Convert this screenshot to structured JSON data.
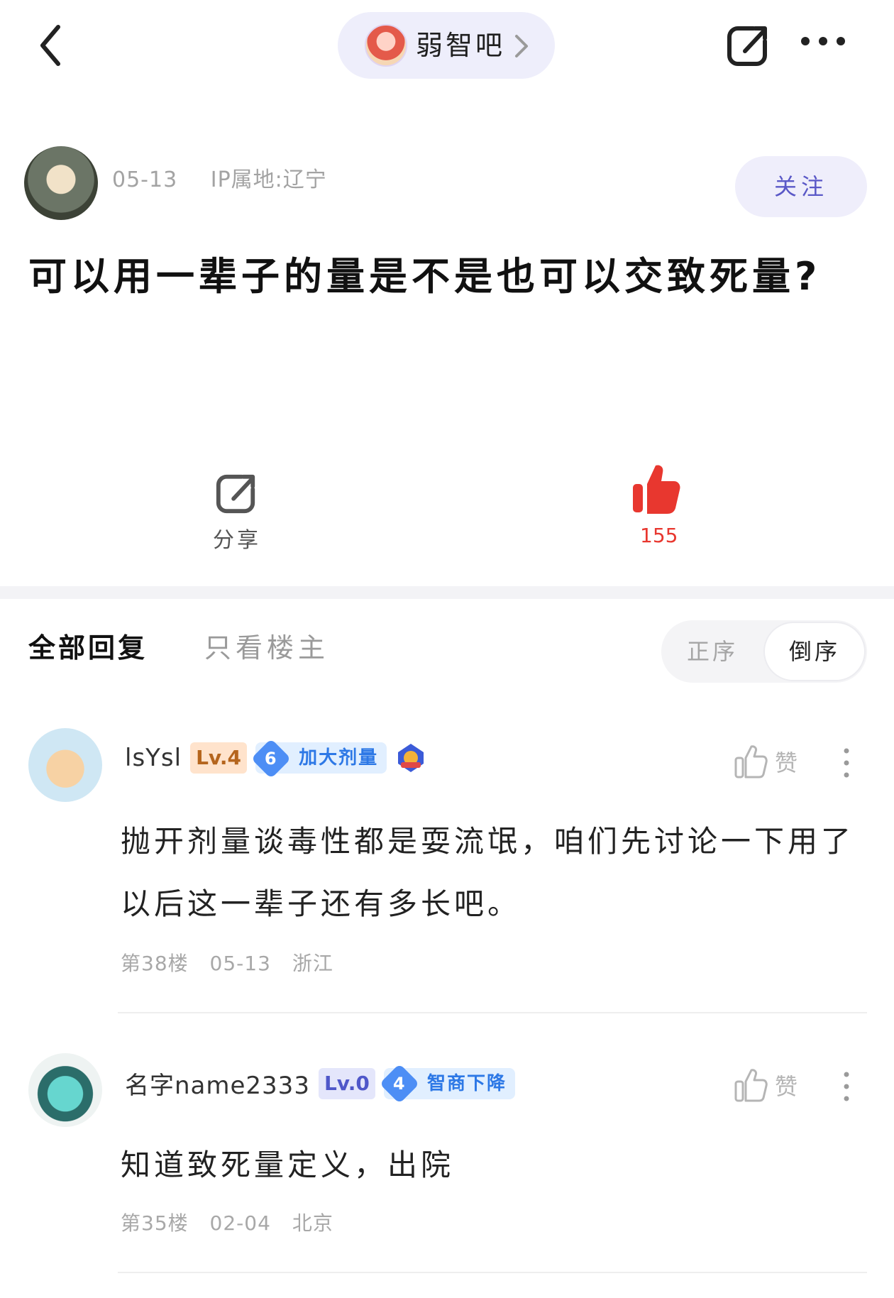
{
  "header": {
    "forum_name": "弱智吧",
    "back_icon": "back-arrow-icon",
    "share_icon": "share-icon",
    "more_icon": "more-icon"
  },
  "post": {
    "date": "05-13",
    "ip_location": "IP属地:辽宁",
    "follow_label": "关注",
    "title": "可以用一辈子的量是不是也可以交致死量?"
  },
  "actions": {
    "share_label": "分享",
    "like_count": "155"
  },
  "tabs": {
    "all_replies": "全部回复",
    "only_op": "只看楼主",
    "sort_asc": "正序",
    "sort_desc": "倒序"
  },
  "comments": [
    {
      "username": "lsYsl",
      "level": "Lv.4",
      "badge_num": "6",
      "badge_text": "加大剂量",
      "like_label": "赞",
      "text": "抛开剂量谈毒性都是耍流氓，咱们先讨论一下用了以后这一辈子还有多长吧。",
      "floor": "第38楼",
      "date": "05-13",
      "location": "浙江"
    },
    {
      "username": "名字name2333",
      "level": "Lv.0",
      "badge_num": "4",
      "badge_text": "智商下降",
      "like_label": "赞",
      "text": "知道致死量定义，出院",
      "floor": "第35楼",
      "date": "02-04",
      "location": "北京"
    }
  ],
  "colors": {
    "accent_purple": "#5a58c7",
    "like_red": "#e8372f",
    "badge_blue": "#2d78e6"
  }
}
